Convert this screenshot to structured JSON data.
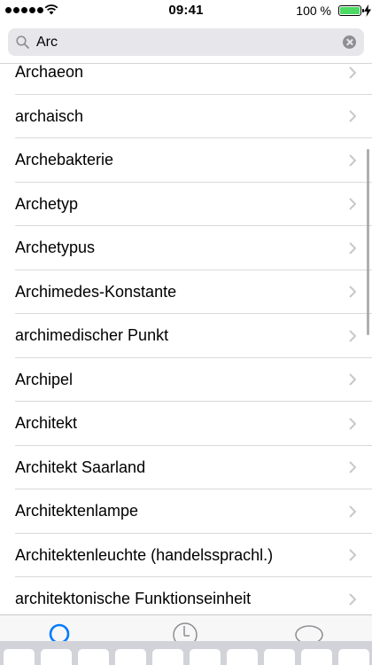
{
  "status_bar": {
    "time": "09:41",
    "battery_percent": "100 %",
    "battery_color": "#4cd964"
  },
  "search": {
    "value": "Arc",
    "placeholder": ""
  },
  "results": [
    "Archaeon",
    "archaisch",
    "Archebakterie",
    "Archetyp",
    "Archetypus",
    "Archimedes-Konstante",
    "archimedischer Punkt",
    "Archipel",
    "Architekt",
    "Architekt Saarland",
    "Architektenlampe",
    "Architektenleuchte (handelssprachl.)",
    "architektonische Funktionseinheit"
  ],
  "tab_bar": {
    "accent_color": "#007aff",
    "tabs": [
      "search-icon",
      "clock-icon",
      "chat-bubble-icon"
    ]
  }
}
